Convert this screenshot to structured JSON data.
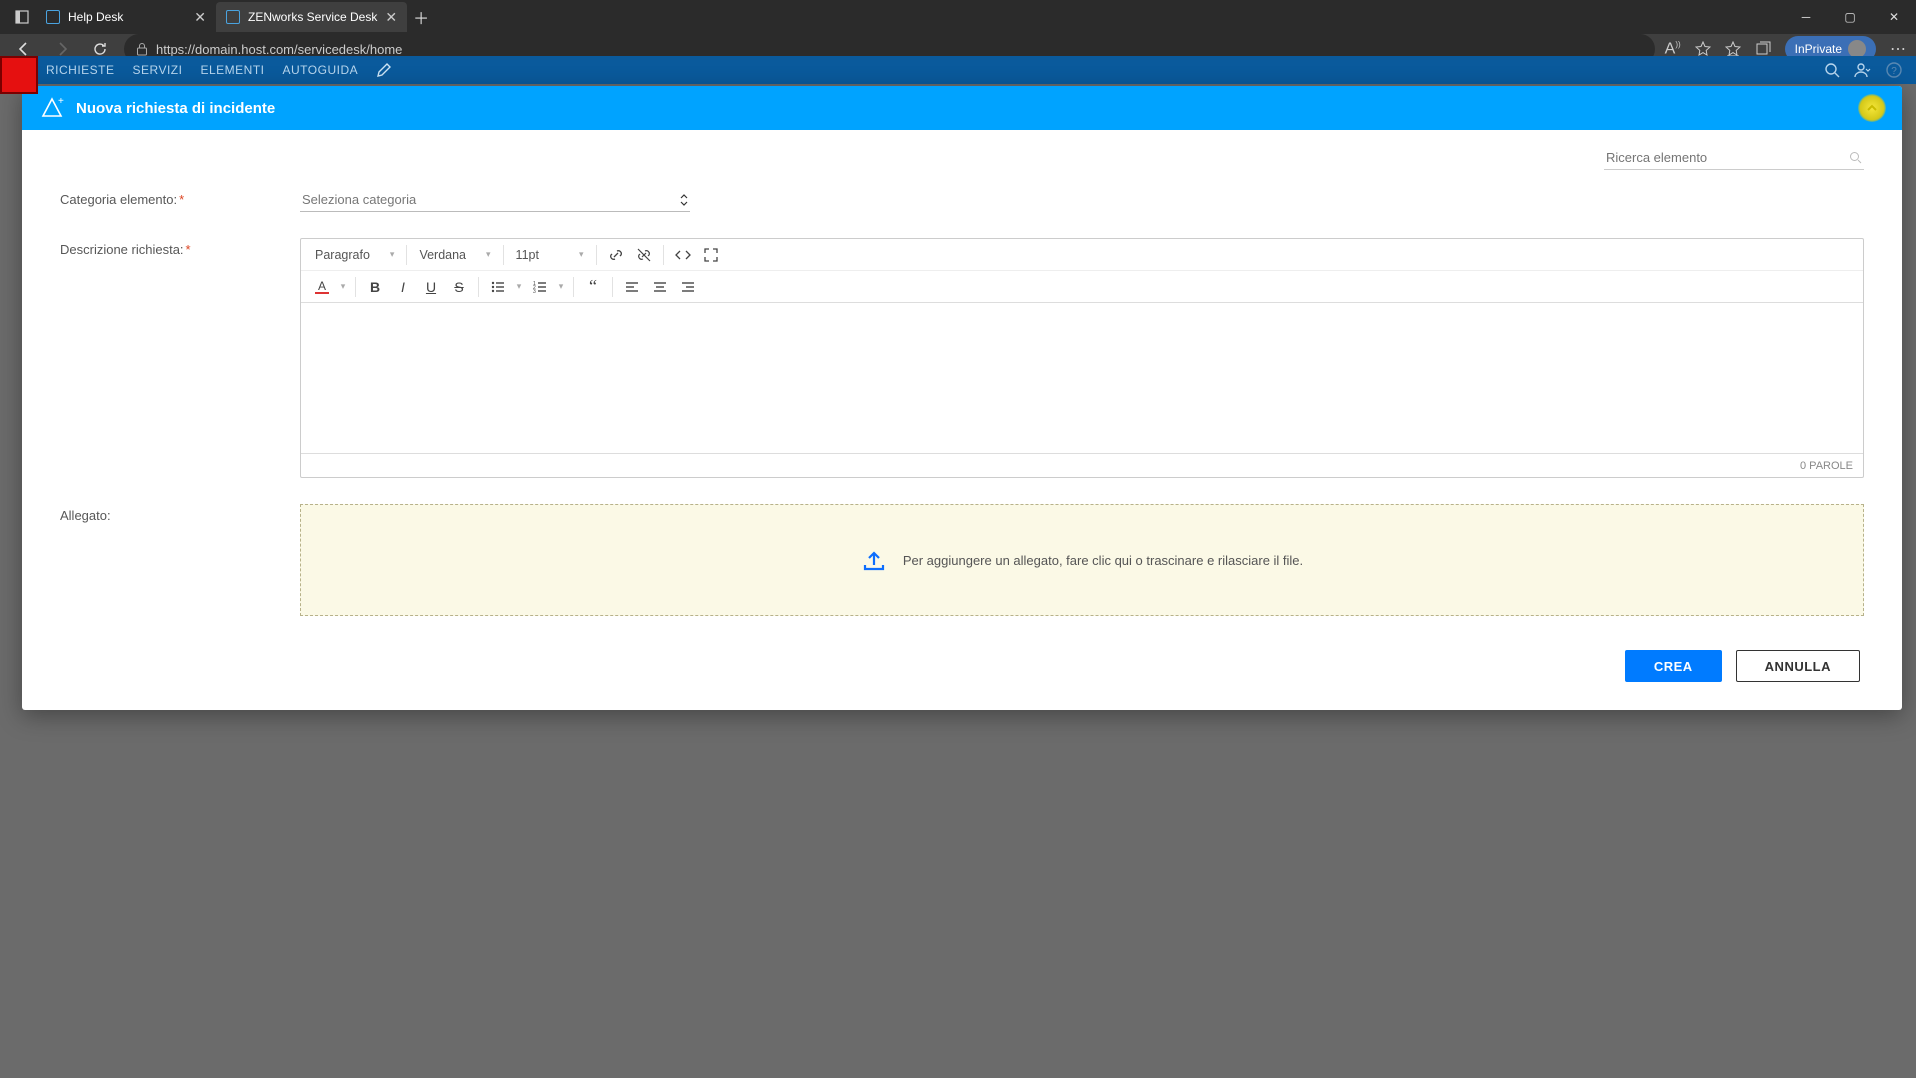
{
  "browser": {
    "tabs": [
      {
        "title": "Help Desk",
        "active": false
      },
      {
        "title": "ZENworks Service Desk",
        "active": true
      }
    ],
    "url": "https://domain.host.com/servicedesk/home",
    "inprivate_label": "InPrivate"
  },
  "app_nav": {
    "items": [
      "RICHIESTE",
      "SERVIZI",
      "ELEMENTI",
      "AUTOGUIDA"
    ]
  },
  "modal": {
    "title": "Nuova richiesta di incidente",
    "search_placeholder": "Ricerca elemento",
    "fields": {
      "category_label": "Categoria elemento:",
      "category_placeholder": "Seleziona categoria",
      "description_label": "Descrizione richiesta:",
      "attachment_label": "Allegato:",
      "attachment_hint": "Per aggiungere un allegato, fare clic qui o trascinare e rilasciare il file."
    },
    "editor": {
      "block_format": "Paragrafo",
      "font_family": "Verdana",
      "font_size": "11pt",
      "word_count": "0 PAROLE"
    },
    "buttons": {
      "create": "CREA",
      "cancel": "ANNULLA"
    }
  }
}
